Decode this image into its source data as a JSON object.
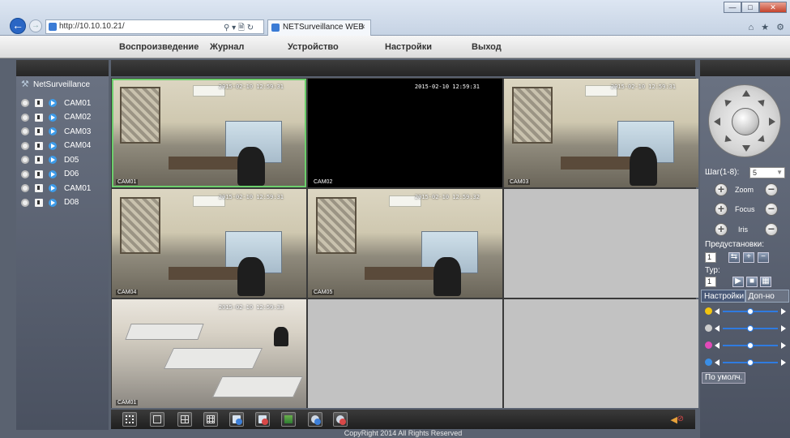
{
  "browser": {
    "url": "http://10.10.10.21/",
    "tab_title": "NETSurveillance WEB",
    "tab_close": "×",
    "addr_tools": "⚲ ▾ 🗎 ↻",
    "icons": "⌂ ★ ⚙",
    "window_controls": [
      "—",
      "□",
      "✕"
    ]
  },
  "menu": [
    "Воспроизведение",
    "Журнал",
    "Устройство",
    "Настройки",
    "Выход"
  ],
  "tree": {
    "root": "NetSurveillance",
    "cameras": [
      "CAM01",
      "CAM02",
      "CAM03",
      "CAM04",
      "D05",
      "D06",
      "CAM01",
      "D08"
    ]
  },
  "grid": {
    "cells": [
      {
        "type": "feed",
        "timestamp": "2015-02-10 12:59:31",
        "name": "CAM01",
        "active": true
      },
      {
        "type": "black",
        "timestamp": "2015-02-10 12:59:31",
        "name": "CAM02"
      },
      {
        "type": "feed",
        "timestamp": "2015-02-10 12:59:31",
        "name": "CAM03"
      },
      {
        "type": "feed",
        "timestamp": "2015-02-10 12:59:31",
        "name": "CAM04"
      },
      {
        "type": "feed",
        "timestamp": "2015-02-10 12:59:32",
        "name": "CAM05"
      },
      {
        "type": "empty"
      },
      {
        "type": "office",
        "timestamp": "2015-02-10 12:59:33",
        "name": "CAM01"
      },
      {
        "type": "empty"
      },
      {
        "type": "empty"
      }
    ]
  },
  "toolbar": {
    "buttons": [
      "fullscreen-icon",
      "layout-1-icon",
      "layout-4-icon",
      "layout-9-icon",
      "record-all-icon",
      "stop-record-icon",
      "snapshot-icon",
      "talk-icon",
      "stop-talk-icon"
    ],
    "sound_icon": "speaker-icon",
    "sound_glyph": "◀",
    "mute_glyph": "⊘"
  },
  "footer": {
    "copyright": "CopyRight 2014 All Rights Reserved"
  },
  "ptz": {
    "step_label": "Шаг(1-8):",
    "step_value": "5",
    "zoom_label": "Zoom",
    "focus_label": "Focus",
    "iris_label": "Iris",
    "presets_label": "Предустановки:",
    "preset_value": "1",
    "tour_label": "Тур:",
    "tour_value": "1",
    "plus": "+",
    "minus": "−"
  },
  "settings": {
    "tab_active": "Настройки",
    "tab_inactive": "Доп-но",
    "sliders": [
      {
        "name": "brightness",
        "color": "#f2c40f",
        "value": 0.5
      },
      {
        "name": "contrast",
        "color": "#cccccc",
        "value": 0.5
      },
      {
        "name": "saturation",
        "color": "#e24ab8",
        "value": 0.5
      },
      {
        "name": "hue",
        "color": "#3a8ee6",
        "value": 0.5
      }
    ],
    "default_button": "По умолч."
  }
}
